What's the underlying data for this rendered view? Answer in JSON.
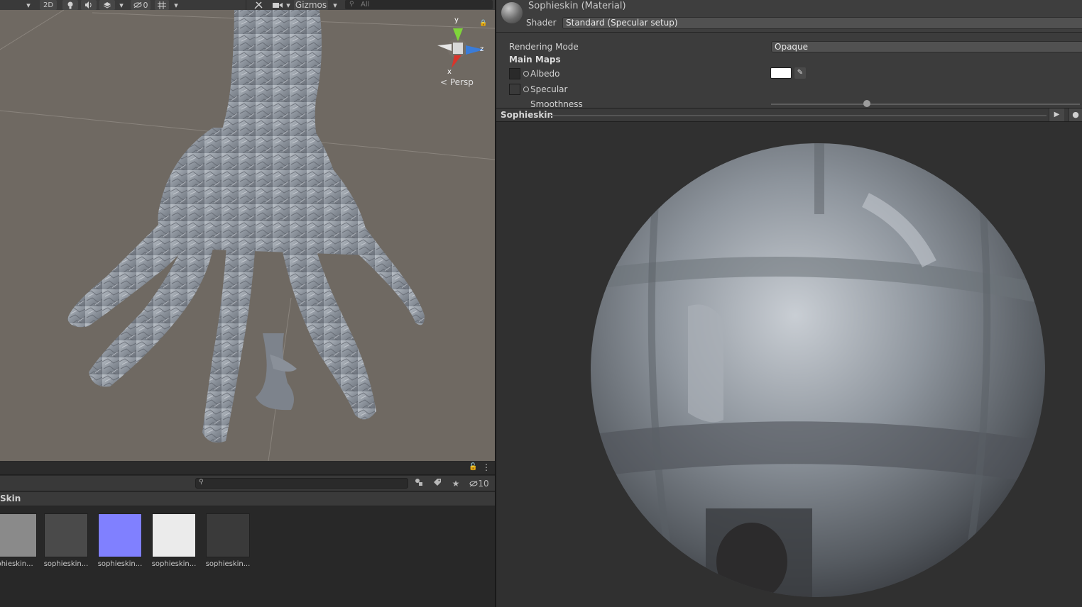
{
  "scene_toolbar": {
    "mode_2d": "2D",
    "hidden_count": "0",
    "gizmos_label": "Gizmos",
    "search_placeholder": "All"
  },
  "scene_view": {
    "axis_y": "y",
    "axis_z": "z",
    "axis_x": "x",
    "projection": "< Persp"
  },
  "inspector": {
    "material_title": "Sophieskin (Material)",
    "shader_label": "Shader",
    "shader_value": "Standard (Specular setup)",
    "rendering_mode_label": "Rendering Mode",
    "rendering_mode_value": "Opaque",
    "main_maps_label": "Main Maps",
    "albedo_label": "Albedo",
    "albedo_color": "#ffffff",
    "specular_label": "Specular",
    "smoothness_label": "Smoothness",
    "smoothness_value": 0.31
  },
  "preview": {
    "title": "Sophieskin"
  },
  "project": {
    "hidden_count": "10",
    "breadcrumb": "Skin",
    "assets": [
      {
        "label": "phieskin...",
        "color": "#8a8a8a"
      },
      {
        "label": "sophieskin...",
        "color": "#4a4a4a"
      },
      {
        "label": "sophieskin...",
        "color": "#8080ff"
      },
      {
        "label": "sophieskin...",
        "color": "#ebebeb"
      },
      {
        "label": "sophieskin...",
        "color": "#3a3a3a"
      }
    ]
  }
}
